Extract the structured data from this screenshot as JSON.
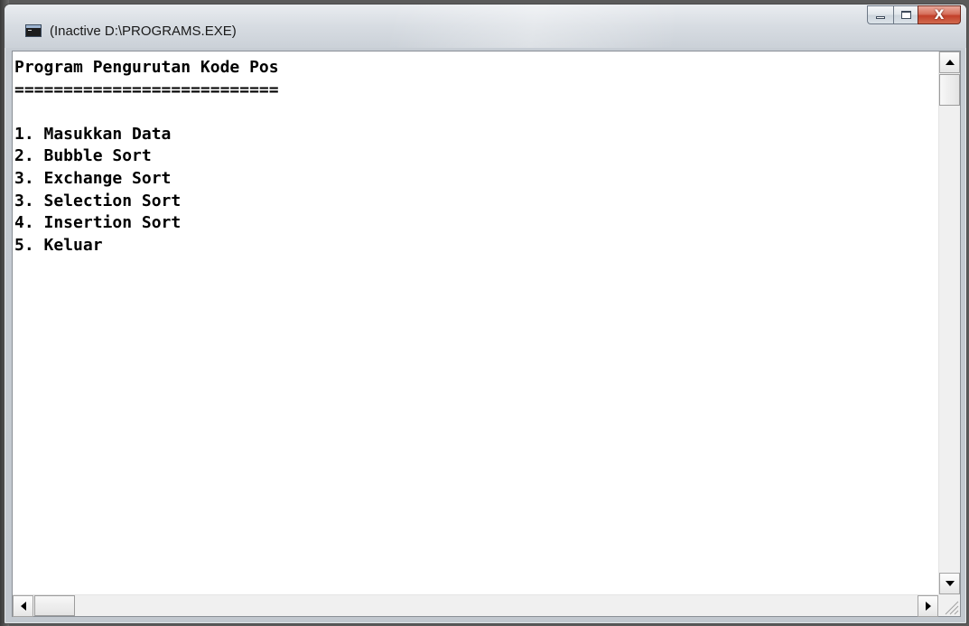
{
  "window": {
    "title": "(Inactive D:\\PROGRAMS.EXE)",
    "close_glyph": "X"
  },
  "console": {
    "lines": [
      "Program Pengurutan Kode Pos",
      "===========================",
      "",
      "1. Masukkan Data",
      "2. Bubble Sort",
      "3. Exchange Sort",
      "3. Selection Sort",
      "4. Insertion Sort",
      "5. Keluar"
    ]
  },
  "icons": {
    "app": "console-app-icon",
    "minimize": "minimize-icon",
    "maximize": "maximize-icon",
    "close": "close-icon",
    "scroll_up": "arrow-up-icon",
    "scroll_down": "arrow-down-icon",
    "scroll_left": "arrow-left-icon",
    "scroll_right": "arrow-right-icon",
    "resize": "size-grip-icon"
  },
  "colors": {
    "console_bg": "#ffffff",
    "console_text": "#000000",
    "close_button": "#c2402a",
    "frame": "#cdd3da"
  }
}
